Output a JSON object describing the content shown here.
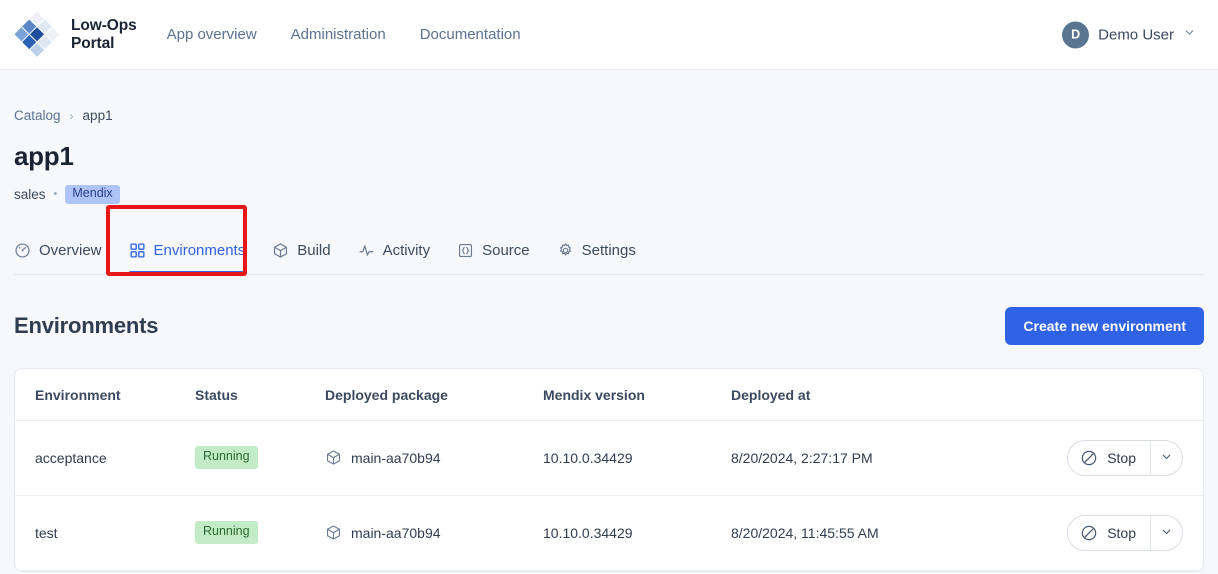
{
  "header": {
    "brand": {
      "line1": "Low-Ops",
      "line2": "Portal",
      "logo_icon": "diamond-grid-logo"
    },
    "nav": [
      {
        "label": "App overview",
        "name": "nav-app-overview"
      },
      {
        "label": "Administration",
        "name": "nav-administration"
      },
      {
        "label": "Documentation",
        "name": "nav-documentation"
      }
    ],
    "user": {
      "initial": "D",
      "name": "Demo User",
      "caret_icon": "chevron-down-icon"
    }
  },
  "breadcrumb": {
    "root": "Catalog",
    "separator": "›",
    "current": "app1"
  },
  "page": {
    "title": "app1",
    "owner": "sales",
    "meta_separator": "•",
    "platform_tag": "Mendix"
  },
  "tabs": [
    {
      "label": "Overview",
      "icon": "gauge-icon",
      "active": false
    },
    {
      "label": "Environments",
      "icon": "grid-squares-icon",
      "active": true
    },
    {
      "label": "Build",
      "icon": "package-icon",
      "active": false
    },
    {
      "label": "Activity",
      "icon": "pulse-icon",
      "active": false
    },
    {
      "label": "Source",
      "icon": "curly-braces-icon",
      "active": false
    },
    {
      "label": "Settings",
      "icon": "gear-icon",
      "active": false
    }
  ],
  "section": {
    "title": "Environments",
    "create_button": "Create new environment"
  },
  "table": {
    "columns": [
      "Environment",
      "Status",
      "Deployed package",
      "Mendix version",
      "Deployed at"
    ],
    "rows": [
      {
        "environment": "acceptance",
        "status": "Running",
        "package": "main-aa70b94",
        "package_icon": "package-icon",
        "mendix_version": "10.10.0.34429",
        "deployed_at": "8/20/2024, 2:27:17 PM",
        "action_label": "Stop",
        "action_icon": "prohibition-icon",
        "action_caret_icon": "chevron-down-icon"
      },
      {
        "environment": "test",
        "status": "Running",
        "package": "main-aa70b94",
        "package_icon": "package-icon",
        "mendix_version": "10.10.0.34429",
        "deployed_at": "8/20/2024, 11:45:55 AM",
        "action_label": "Stop",
        "action_icon": "prohibition-icon",
        "action_caret_icon": "chevron-down-icon"
      }
    ]
  },
  "annotation": {
    "highlight_color": "#e81717",
    "target": "Environments"
  },
  "colors": {
    "accent": "#2f62e5",
    "badge_running_bg": "#c2ecc6",
    "badge_running_text": "#2c6b33",
    "tag_mendix_bg": "#aec4f6",
    "tag_mendix_text": "#2a3f8f",
    "page_bg": "#f6f8fb"
  }
}
